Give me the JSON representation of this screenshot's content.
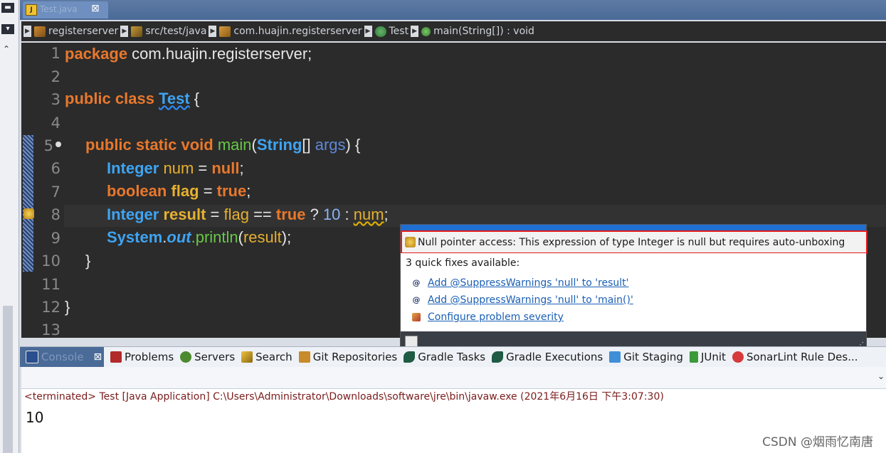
{
  "editor_tab": {
    "label": "Test.java",
    "close": "⊠",
    "icon": "java-file-icon"
  },
  "breadcrumb": [
    {
      "label": "registerserver",
      "icon": "project-icon"
    },
    {
      "label": "src/test/java",
      "icon": "source-folder-icon"
    },
    {
      "label": "com.huajin.registerserver",
      "icon": "package-icon"
    },
    {
      "label": "Test",
      "icon": "class-icon"
    },
    {
      "label": "main(String[]) : void",
      "icon": "method-icon"
    }
  ],
  "editor": {
    "line_numbers": [
      "1",
      "2",
      "3",
      "4",
      "5",
      "6",
      "7",
      "8",
      "9",
      "10",
      "11",
      "12",
      "13"
    ],
    "lines": {
      "l1": {
        "kw": "package",
        "rest": " com.huajin.registerserver;"
      },
      "l3": {
        "kw": "public class",
        "cls": "Test",
        "rest": " {"
      },
      "l5": {
        "kw": "public static void",
        "mth": "main",
        "p1": "(",
        "cls": "String",
        "p2": "[] ",
        "arg": "args",
        "rest": ") {"
      },
      "l6": {
        "cls": "Integer",
        "var": "num",
        "eq": " = ",
        "kw": "null",
        "rest": ";"
      },
      "l7": {
        "kw": "boolean",
        "var": "flag",
        "eq": " = ",
        "kw2": "true",
        "rest": ";"
      },
      "l8": {
        "cls": "Integer",
        "var": "result",
        "eq": " = ",
        "var2": "flag",
        "op": " == ",
        "kw": "true",
        "op2": " ? ",
        "num": "10",
        "op3": " : ",
        "var3": "num",
        "rest": ";"
      },
      "l9": {
        "cls": "System",
        "dot": ".",
        "fld": "out",
        "mth": ".println",
        "p1": "(",
        "var": "result",
        "rest": ");"
      },
      "l10": {
        "rest": "}"
      },
      "l12": {
        "rest": "}"
      }
    }
  },
  "popup": {
    "message": "Null pointer access: This expression of type Integer is null but requires auto-unboxing",
    "fixes_title": "3 quick fixes available:",
    "fixes": [
      {
        "label": "Add @SuppressWarnings 'null' to 'result'",
        "icon": "annotation-icon"
      },
      {
        "label": "Add @SuppressWarnings 'null' to 'main()'",
        "icon": "annotation-icon"
      },
      {
        "label": "Configure problem severity",
        "icon": "configure-icon"
      }
    ]
  },
  "views": {
    "tabs": [
      {
        "label": "Console",
        "icon": "console-icon",
        "active": true
      },
      {
        "label": "Problems",
        "icon": "problems-icon"
      },
      {
        "label": "Servers",
        "icon": "servers-icon"
      },
      {
        "label": "Search",
        "icon": "search-icon"
      },
      {
        "label": "Git Repositories",
        "icon": "git-repositories-icon"
      },
      {
        "label": "Gradle Tasks",
        "icon": "gradle-icon"
      },
      {
        "label": "Gradle Executions",
        "icon": "gradle-icon"
      },
      {
        "label": "Git Staging",
        "icon": "git-staging-icon"
      },
      {
        "label": "JUnit",
        "icon": "junit-icon"
      },
      {
        "label": "SonarLint Rule Des...",
        "icon": "sonarlint-icon"
      }
    ],
    "close_glyph": "⊠"
  },
  "console": {
    "terminated": "<terminated> Test [Java Application] C:\\Users\\Administrator\\Downloads\\software\\jre\\bin\\javaw.exe (2021年6月16日 下午3:07:30)",
    "output": "10"
  },
  "watermark": "CSDN @烟雨忆南唐",
  "colors": {
    "editor_bg": "#2b2b2b",
    "keyword": "#e8782c",
    "class": "#3ea4f2",
    "popup_border": "#e31b1b"
  }
}
